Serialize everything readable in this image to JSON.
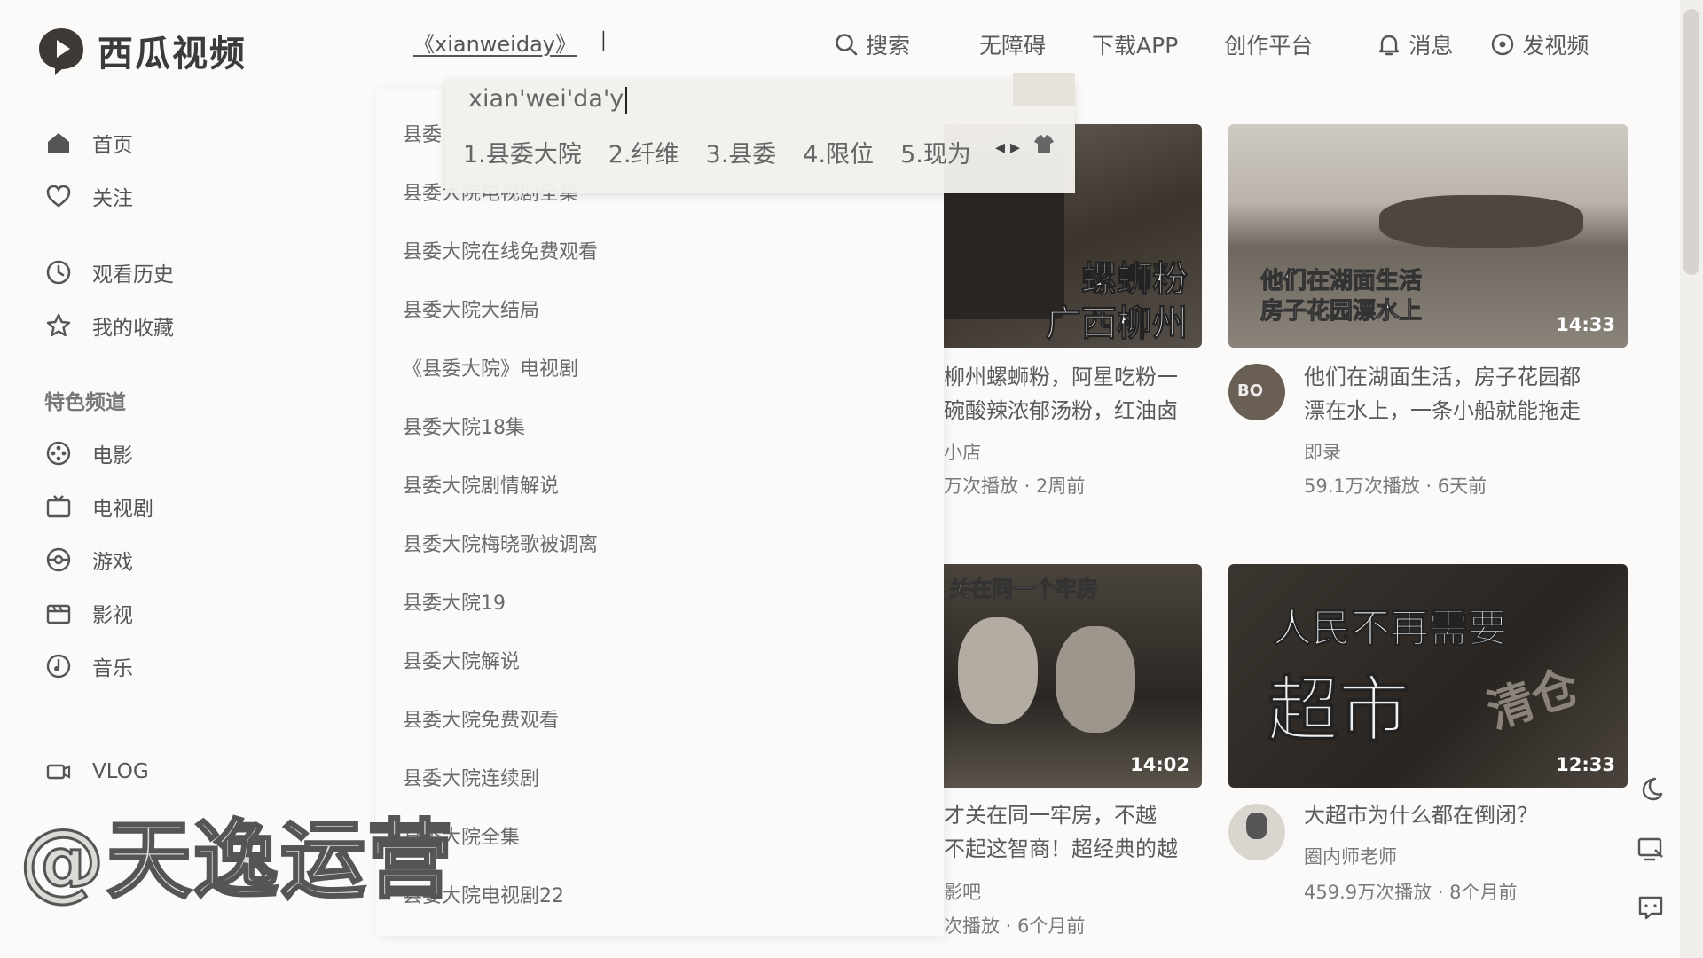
{
  "brand": {
    "name": "西瓜视频"
  },
  "search": {
    "value": "《xianweiday》"
  },
  "header": {
    "search": "搜索",
    "accessibility": "无障碍",
    "download": "下载APP",
    "creator": "创作平台",
    "messages": "消息",
    "upload": "发视频"
  },
  "sidebar": {
    "items": [
      {
        "label": "首页"
      },
      {
        "label": "关注"
      },
      {
        "label": "观看历史"
      },
      {
        "label": "我的收藏"
      }
    ],
    "section_title": "特色频道",
    "channels": [
      {
        "label": "电影"
      },
      {
        "label": "电视剧"
      },
      {
        "label": "游戏"
      },
      {
        "label": "影视"
      },
      {
        "label": "音乐"
      },
      {
        "label": "VLOG"
      }
    ]
  },
  "ime": {
    "input": "xian'wei'da'y",
    "candidates": [
      "1.县委大院",
      "2.纤维",
      "3.县委",
      "4.限位",
      "5.现为"
    ]
  },
  "suggestions": [
    "县委",
    "县委大院电视剧全集",
    "县委大院在线免费观看",
    "县委大院大结局",
    "《县委大院》电视剧",
    "县委大院18集",
    "县委大院剧情解说",
    "县委大院梅晓歌被调离",
    "县委大院19",
    "县委大院解说",
    "县委大院免费观看",
    "县委大院连续剧",
    "县委大院全集",
    "县委大院电视剧22"
  ],
  "videos": [
    {
      "thumb_text": [
        "螺蛳粉",
        "广西柳州"
      ],
      "title": "柳州螺蛳粉，阿星吃粉一\n碗酸辣浓郁汤粉，红油卤",
      "author": "小店",
      "meta": "万次播放 · 2周前"
    },
    {
      "thumb_text": [
        "他们在湖面生活",
        "房子花园漂水上"
      ],
      "duration": "14:33",
      "title": "他们在湖面生活，房子花园都\n漂在水上，一条小船就能拖走",
      "author": "即录",
      "meta": "59.1万次播放 · 6天前"
    },
    {
      "thumb_text": [
        "关在同一个牢房"
      ],
      "duration": "14:02",
      "title": "才关在同一牢房，不越\n不起这智商！超经典的越",
      "author": "影吧",
      "meta": "次播放 · 6个月前"
    },
    {
      "thumb_text": [
        "人民不再需要",
        "超市",
        "清仓"
      ],
      "duration": "12:33",
      "title": "大超市为什么都在倒闭？",
      "author": "圈内师老师",
      "meta": "459.9万次播放 · 8个月前"
    }
  ],
  "watermark": "@天逸运营",
  "colors": {
    "background": "#fbfaf8",
    "text": "#4a4a4a",
    "logo": "#3d3a36"
  }
}
